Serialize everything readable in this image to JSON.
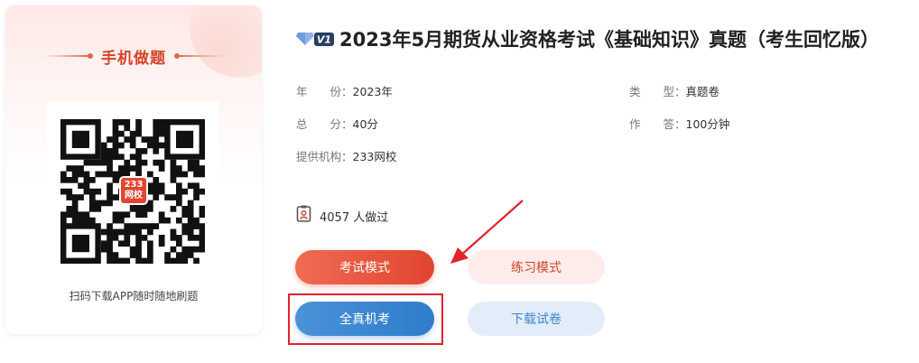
{
  "sidebar": {
    "title": "手机做题",
    "caption": "扫码下载APP随时随地刷题",
    "qr_logo_top": "233",
    "qr_logo_bottom": "网校"
  },
  "exam": {
    "title": "2023年5月期货从业资格考试《基础知识》真题（考生回忆版）",
    "meta": {
      "year_label": "年　　份：",
      "year_value": "2023年",
      "type_label": "类　　型：",
      "type_value": "真题卷",
      "score_label": "总　　分：",
      "score_value": "40分",
      "time_label": "作　　答：",
      "time_value": "100分钟",
      "org_label": "提供机构：",
      "org_value": "233网校"
    },
    "done_count": "4057 人做过"
  },
  "buttons": {
    "exam_mode": "考试模式",
    "practice_mode": "练习模式",
    "full_exam": "全真机考",
    "download": "下载试卷"
  },
  "colors": {
    "accent_red": "#e0452e",
    "accent_blue": "#2e7ccd",
    "highlight_red": "#e3232c"
  }
}
